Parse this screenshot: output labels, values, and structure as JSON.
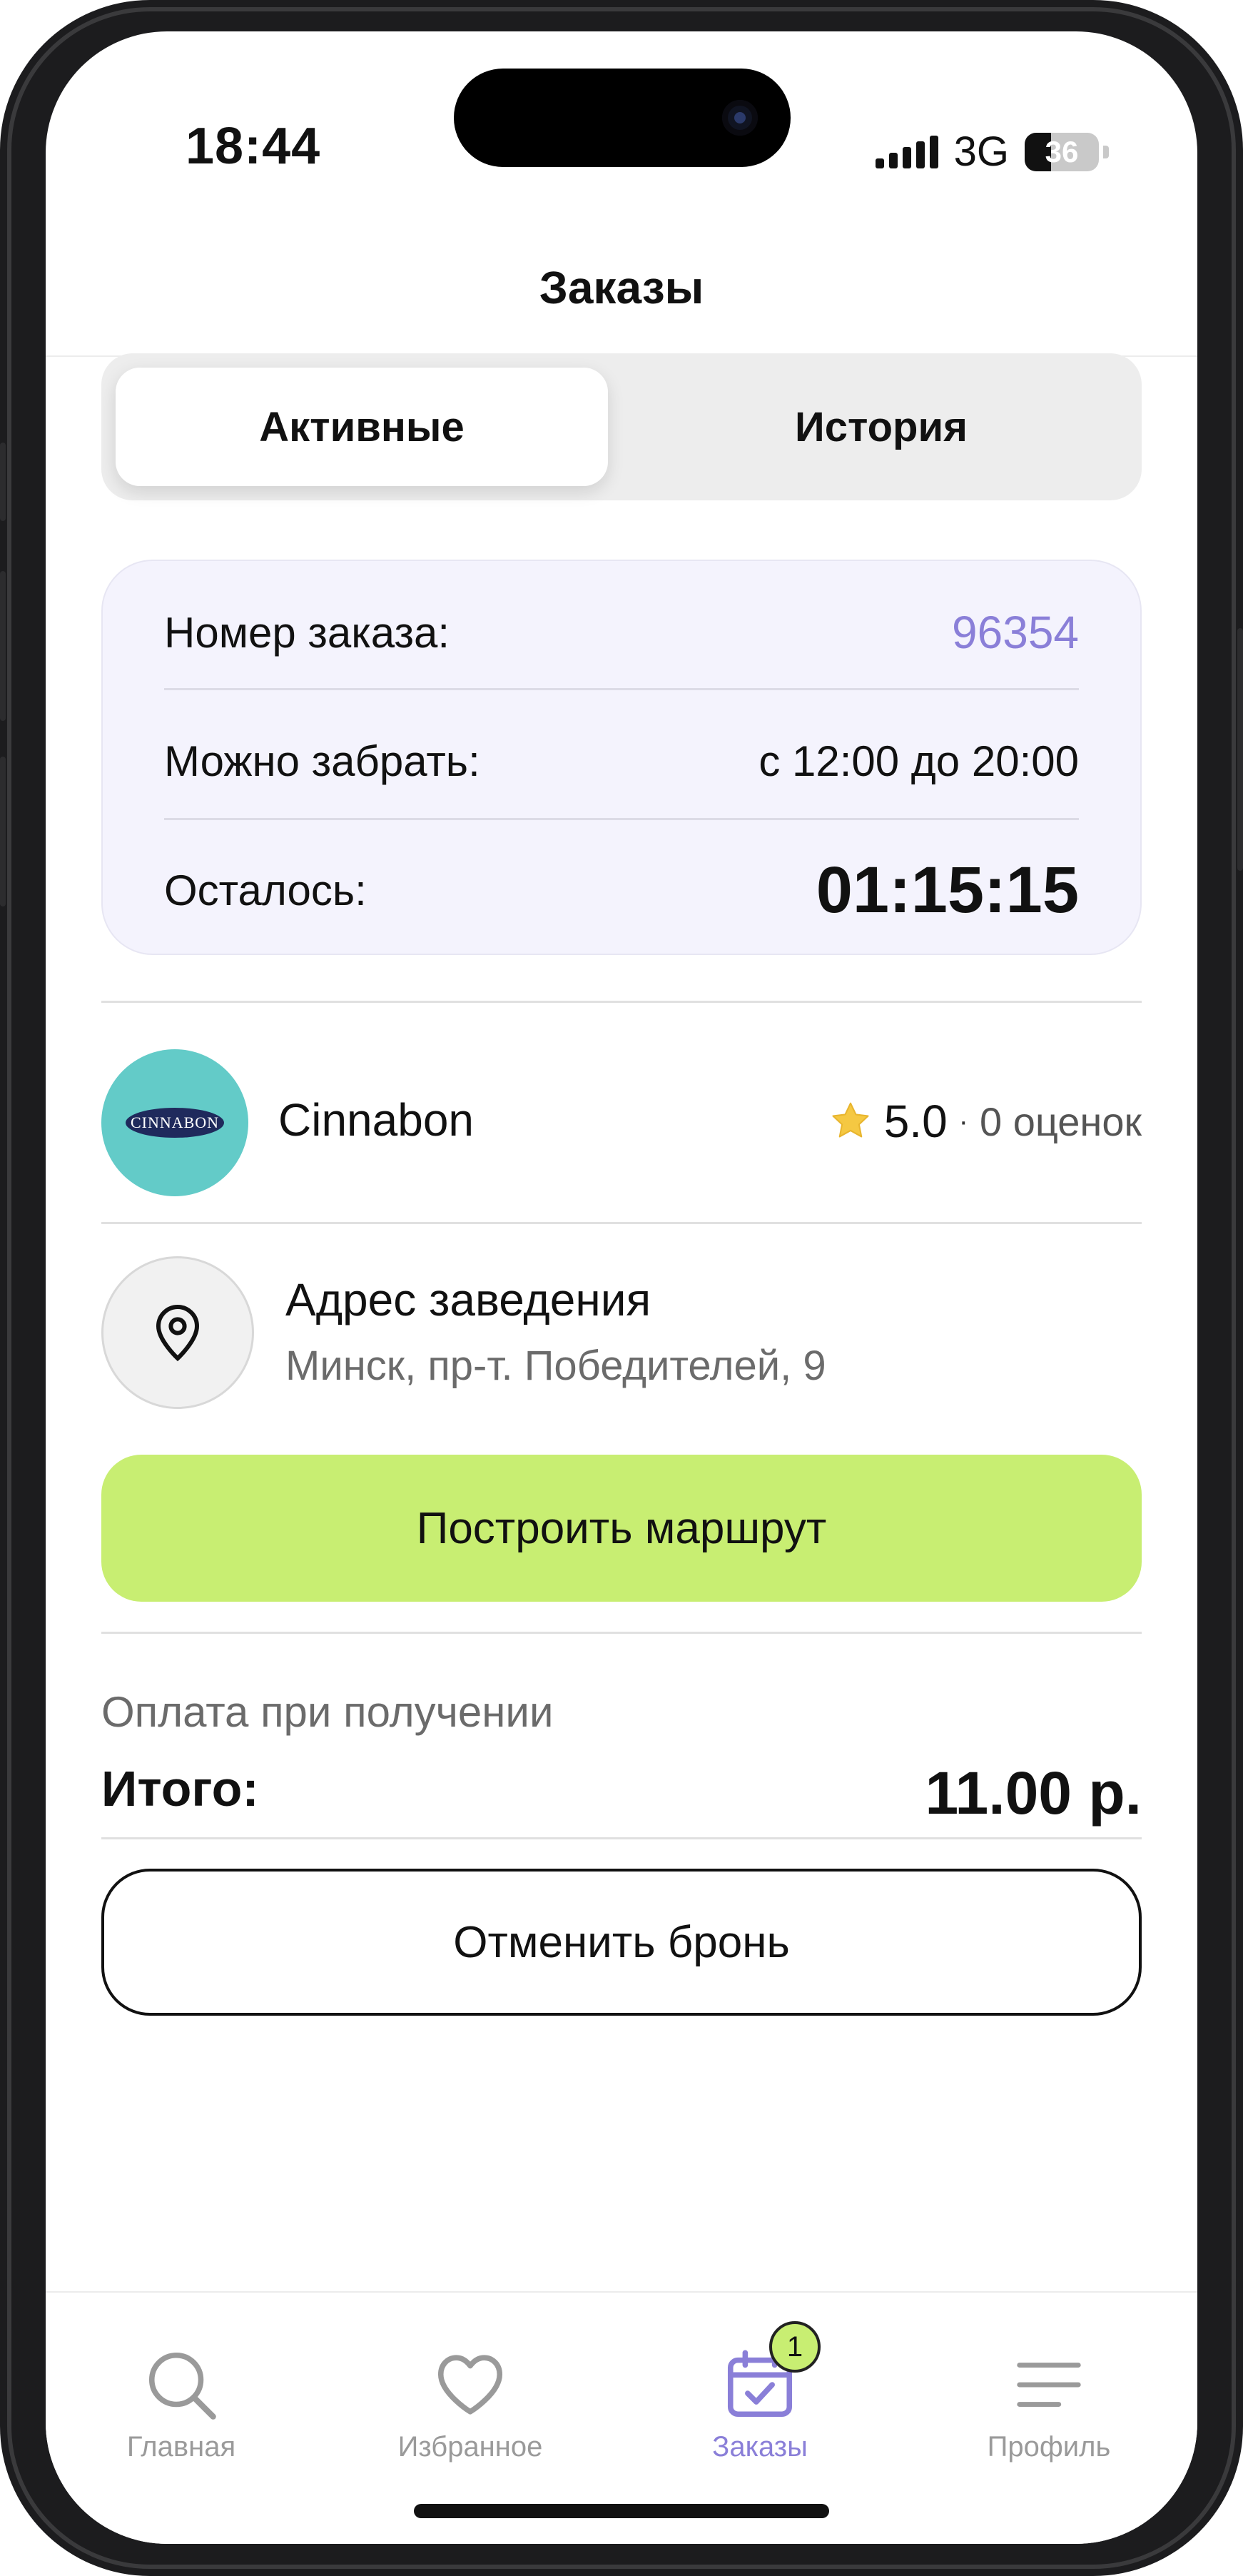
{
  "status_bar": {
    "time": "18:44",
    "network": "3G",
    "battery": "36",
    "battery_level_fraction": 0.36
  },
  "header": {
    "title": "Заказы"
  },
  "segments": {
    "active": "Активные",
    "history": "История"
  },
  "order": {
    "number_label": "Номер заказа:",
    "number_value": "96354",
    "pickup_label": "Можно забрать:",
    "pickup_value": "с 12:00 до 20:00",
    "remaining_label": "Осталось:",
    "remaining_value": "01:15:15"
  },
  "store": {
    "logo_text": "CINNABON",
    "name": "Cinnabon",
    "rating": "5.0",
    "separator": "·",
    "reviews": "0 оценок"
  },
  "address": {
    "title": "Адрес заведения",
    "text": "Минск, пр-т. Победителей, 9"
  },
  "actions": {
    "route": "Построить маршрут",
    "cancel": "Отменить бронь"
  },
  "payment": {
    "note": "Оплата при получении",
    "total_label": "Итого:",
    "total_value": "11.00 р."
  },
  "tabbar": {
    "items": [
      {
        "label": "Главная",
        "icon": "search-icon"
      },
      {
        "label": "Избранное",
        "icon": "heart-icon"
      },
      {
        "label": "Заказы",
        "icon": "calendar-check-icon",
        "badge": "1",
        "active": true
      },
      {
        "label": "Профиль",
        "icon": "menu-icon"
      }
    ]
  },
  "colors": {
    "accent_purple": "#8a7fd8",
    "accent_green": "#c8ee72",
    "logo_teal": "#63cbc8",
    "card_bg": "#f4f3fd"
  }
}
